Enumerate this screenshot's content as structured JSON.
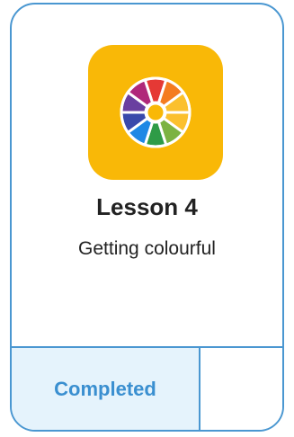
{
  "lesson": {
    "title": "Lesson 4",
    "subtitle": "Getting colourful",
    "icon": "color-wheel-icon",
    "status_label": "Completed"
  },
  "colors": {
    "border": "#4a97d1",
    "icon_background": "#f9b807",
    "status_background": "#e5f3fc",
    "status_text": "#3a8fd0"
  }
}
